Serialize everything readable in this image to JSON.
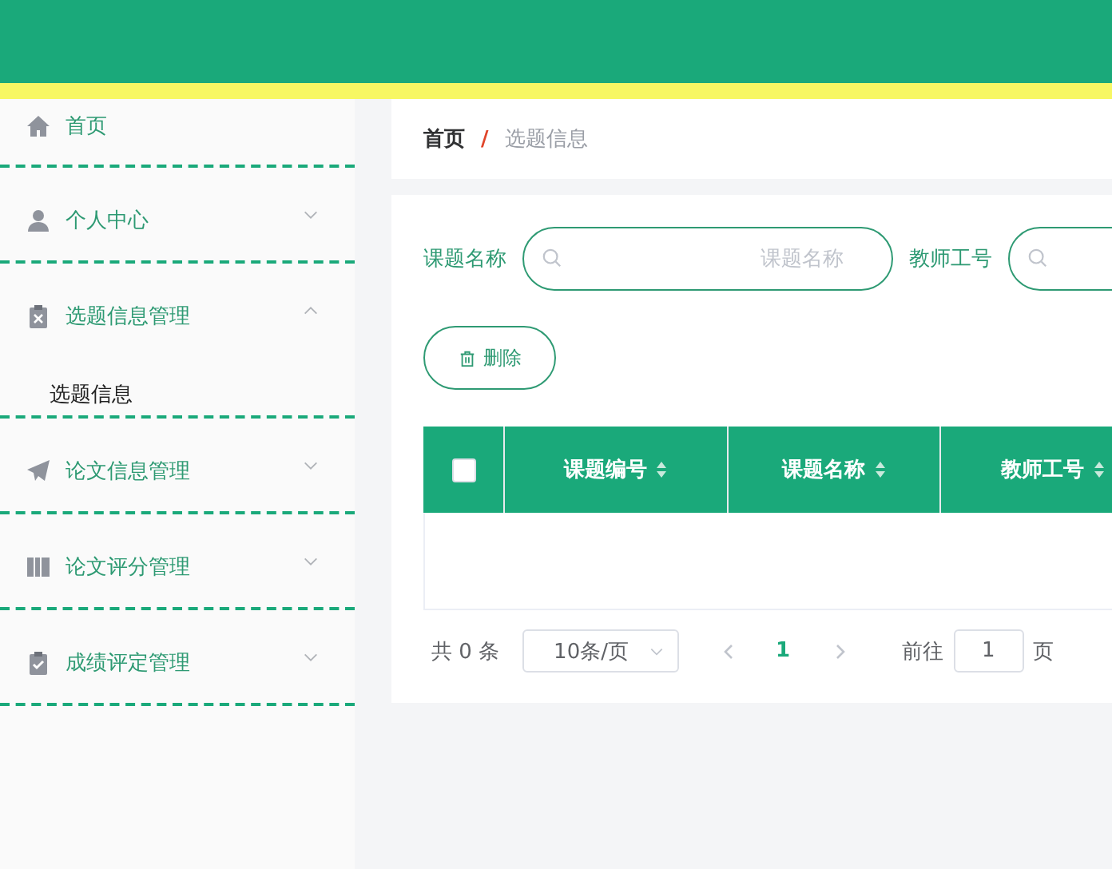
{
  "sidebar": {
    "items": [
      {
        "label": "首页",
        "kind": "link"
      },
      {
        "label": "个人中心",
        "kind": "menu",
        "expanded": false
      },
      {
        "label": "选题信息管理",
        "kind": "menu",
        "expanded": true,
        "children": [
          {
            "label": "选题信息"
          }
        ]
      },
      {
        "label": "论文信息管理",
        "kind": "menu",
        "expanded": false
      },
      {
        "label": "论文评分管理",
        "kind": "menu",
        "expanded": false
      },
      {
        "label": "成绩评定管理",
        "kind": "menu",
        "expanded": false
      }
    ]
  },
  "breadcrumb": {
    "items": [
      "首页",
      "选题信息"
    ],
    "separator": "/"
  },
  "search": {
    "fields": [
      {
        "label": "课题名称",
        "placeholder": "课题名称"
      },
      {
        "label": "教师工号"
      }
    ]
  },
  "buttons": [
    {
      "label": "删除"
    }
  ],
  "table": {
    "select_all": {
      "checked": false
    },
    "columns": [
      {
        "label": "课题编号"
      },
      {
        "label": "课题名称"
      },
      {
        "label": "教师工号"
      }
    ]
  },
  "pagination": {
    "total": "共 0 条",
    "page_size": "10条/页",
    "pages": [
      {
        "label": "1",
        "selected": true
      }
    ],
    "goto_label": "前往",
    "goto_value": "1",
    "goto_suffix": "页"
  }
}
